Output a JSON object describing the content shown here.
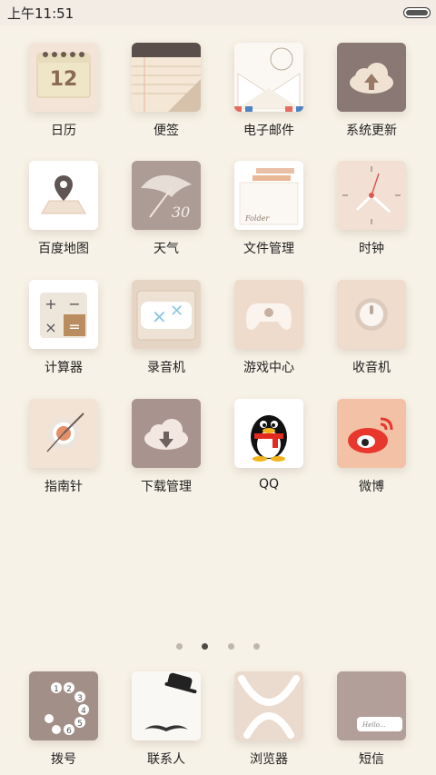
{
  "status_bar": {
    "time": "上午11:51"
  },
  "apps": [
    {
      "id": "calendar",
      "label": "日历",
      "icon": "calendar-icon",
      "day": "12"
    },
    {
      "id": "notes",
      "label": "便签",
      "icon": "notes-icon"
    },
    {
      "id": "email",
      "label": "电子邮件",
      "icon": "envelope-icon"
    },
    {
      "id": "system-update",
      "label": "系统更新",
      "icon": "cloud-upload-icon"
    },
    {
      "id": "baidu-map",
      "label": "百度地图",
      "icon": "map-pin-icon"
    },
    {
      "id": "weather",
      "label": "天气",
      "icon": "umbrella-icon",
      "temp": "30"
    },
    {
      "id": "file-manager",
      "label": "文件管理",
      "icon": "folder-icon",
      "folder_text": "Folder"
    },
    {
      "id": "clock",
      "label": "时钟",
      "icon": "clock-icon"
    },
    {
      "id": "calculator",
      "label": "计算器",
      "icon": "calculator-icon"
    },
    {
      "id": "recorder",
      "label": "录音机",
      "icon": "cassette-icon"
    },
    {
      "id": "game-center",
      "label": "游戏中心",
      "icon": "gamepad-icon"
    },
    {
      "id": "radio",
      "label": "收音机",
      "icon": "radio-knob-icon"
    },
    {
      "id": "compass",
      "label": "指南针",
      "icon": "compass-icon"
    },
    {
      "id": "download-manager",
      "label": "下载管理",
      "icon": "cloud-download-icon"
    },
    {
      "id": "qq",
      "label": "QQ",
      "icon": "penguin-icon"
    },
    {
      "id": "weibo",
      "label": "微博",
      "icon": "weibo-icon"
    }
  ],
  "page_indicator": {
    "count": 4,
    "active_index": 1
  },
  "dock": [
    {
      "id": "dialer",
      "label": "拨号",
      "icon": "rotary-dial-icon"
    },
    {
      "id": "contacts",
      "label": "联系人",
      "icon": "hat-mustache-icon"
    },
    {
      "id": "browser",
      "label": "浏览器",
      "icon": "browser-icon"
    },
    {
      "id": "messages",
      "label": "短信",
      "icon": "message-icon",
      "bubble_text": "Hello..."
    }
  ]
}
